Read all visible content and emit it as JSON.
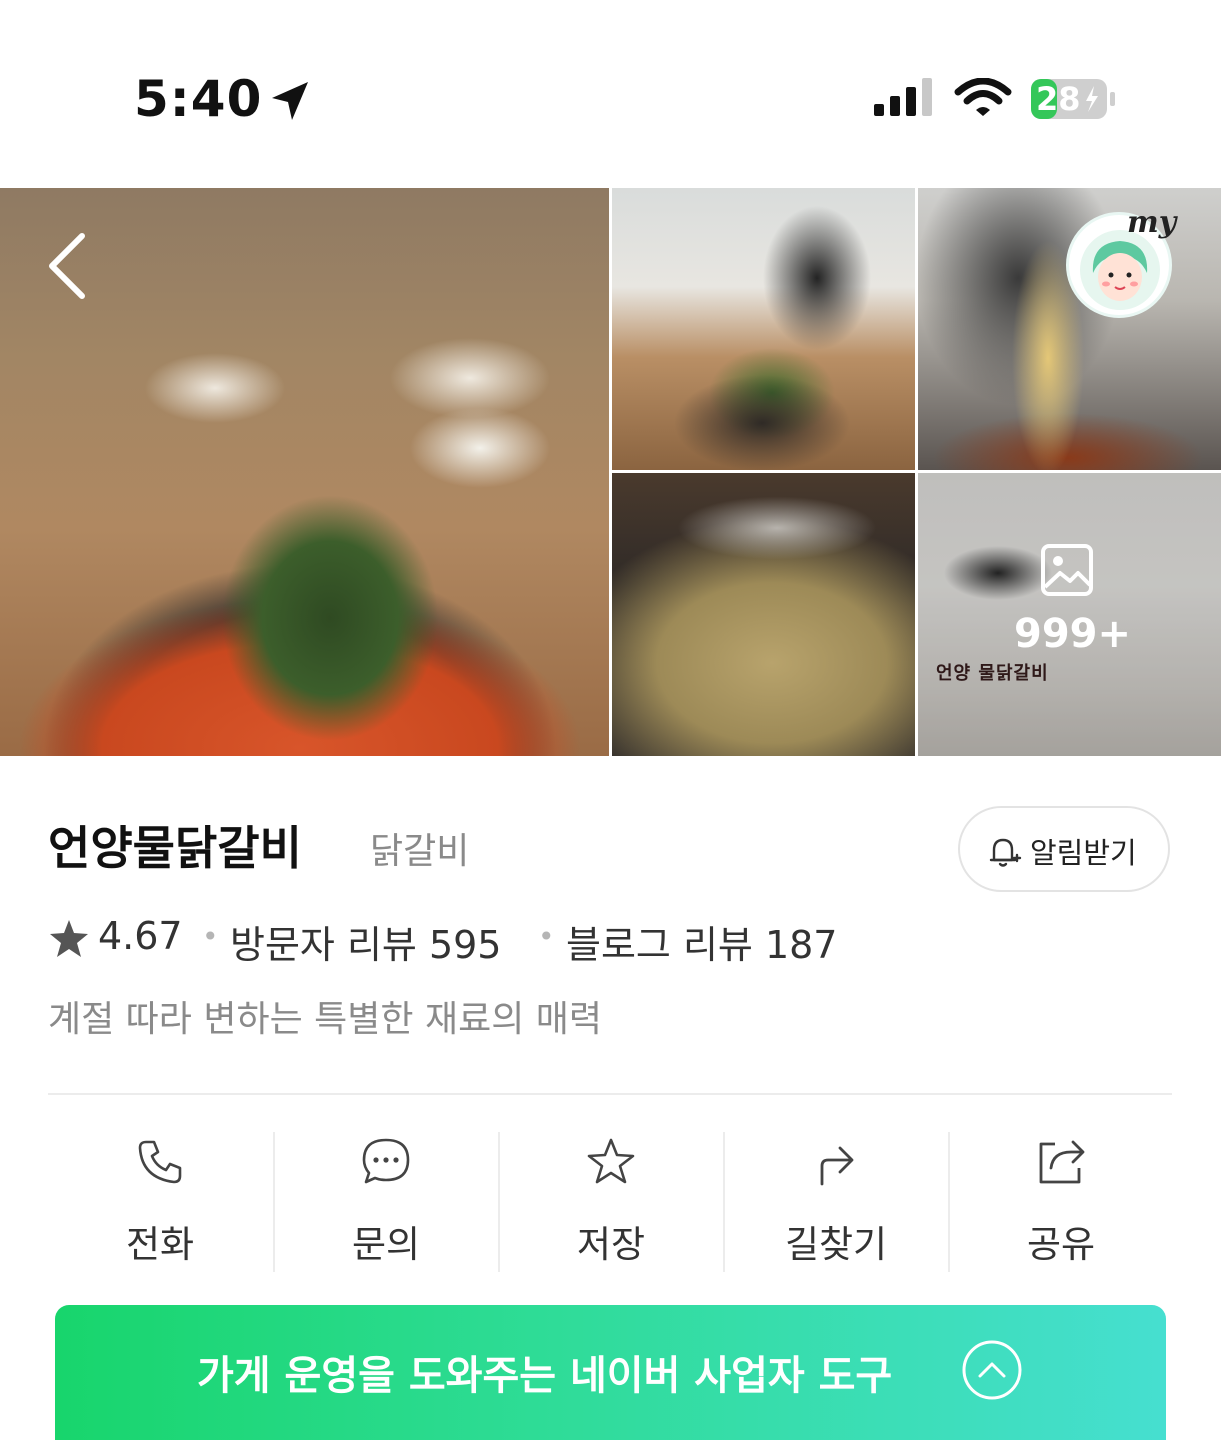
{
  "status_bar": {
    "time": "5:40",
    "battery": "28"
  },
  "photos": {
    "more_count": "999+",
    "sign_text": "언양 물닭갈비"
  },
  "place": {
    "name": "언양물닭갈비",
    "category": "닭갈비",
    "alarm_label": "알림받기",
    "rating": "4.67",
    "visitor_reviews": "방문자 리뷰 595",
    "blog_reviews": "블로그 리뷰 187",
    "tagline": "계절 따라 변하는 특별한 재료의 매력"
  },
  "actions": [
    {
      "label": "전화",
      "icon": "phone-icon"
    },
    {
      "label": "문의",
      "icon": "chat-icon"
    },
    {
      "label": "저장",
      "icon": "star-icon"
    },
    {
      "label": "길찾기",
      "icon": "directions-icon"
    },
    {
      "label": "공유",
      "icon": "share-icon"
    }
  ],
  "banner": {
    "label": "가게 운영을 도와주는 네이버 사업자 도구"
  },
  "colors": {
    "accent_green": "#18d56c",
    "accent_teal": "#46dfd0",
    "battery_green": "#34c759"
  }
}
